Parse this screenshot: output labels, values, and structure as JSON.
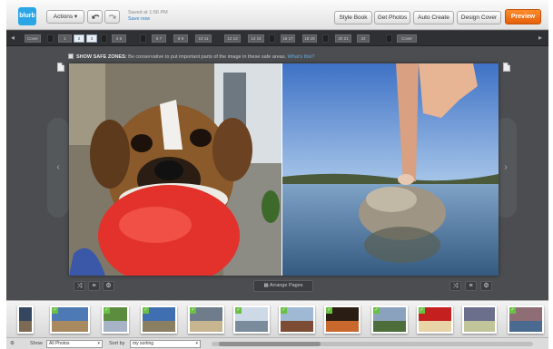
{
  "toolbar": {
    "logo": "blurb",
    "actions_label": "Actions ▾",
    "undo_icon": "undo-icon",
    "redo_icon": "redo-icon",
    "saved_text": "Saved at 1:56 PM",
    "save_now_label": "Save now",
    "style_book_label": "Style Book",
    "get_photos_label": "Get Photos",
    "auto_create_label": "Auto Create",
    "design_cover_label": "Design Cover",
    "preview_label": "Preview"
  },
  "page_strip": {
    "pages": [
      {
        "label": "Cover"
      },
      {
        "label": "1"
      },
      {
        "label": "2",
        "active": true
      },
      {
        "label": "3",
        "active": true
      },
      {
        "label": "4 5"
      },
      {
        "label": "6 7"
      },
      {
        "label": "8 9"
      },
      {
        "label": "10 11"
      },
      {
        "label": "12 13"
      },
      {
        "label": "14 15"
      },
      {
        "label": "16 17"
      },
      {
        "label": "18 19"
      },
      {
        "label": "20 21"
      },
      {
        "label": "22"
      },
      {
        "label": "Cover"
      }
    ]
  },
  "safe_zones": {
    "label": "SHOW SAFE ZONES:",
    "text": "Be conservative to put important parts of the image in these safe areas.",
    "help": "What's this?"
  },
  "spread": {
    "left_photo": "boxer dog holding red ball",
    "right_photo": "finger balancing on rock in lake"
  },
  "controls": {
    "arrange_pages_label": "Arrange Pages"
  },
  "filmstrip": {
    "thumbs": [
      {
        "colors": [
          "#35475e",
          "#7c6a55"
        ],
        "checked": false
      },
      {
        "colors": [
          "#4d7ab5",
          "#a9895f"
        ],
        "checked": true
      },
      {
        "colors": [
          "#5c8d3f",
          "#a7b4c7"
        ],
        "checked": true
      },
      {
        "colors": [
          "#3f6fb0",
          "#8a7e63"
        ],
        "checked": true
      },
      {
        "colors": [
          "#6f7c8c",
          "#c7b58f"
        ],
        "checked": true
      },
      {
        "colors": [
          "#cdd9e6",
          "#7a8c9b"
        ],
        "checked": true
      },
      {
        "colors": [
          "#9fb8d4",
          "#7c4c35"
        ],
        "checked": true
      },
      {
        "colors": [
          "#2a1d14",
          "#c8682c"
        ],
        "checked": true
      },
      {
        "colors": [
          "#8aa2bd",
          "#4d6d3a"
        ],
        "checked": true
      },
      {
        "colors": [
          "#c42020",
          "#e9d4a8"
        ],
        "checked": true
      },
      {
        "colors": [
          "#6c6f8c",
          "#c1c59a"
        ],
        "checked": false
      },
      {
        "colors": [
          "#8e6d75",
          "#4a6a90"
        ],
        "checked": true
      }
    ]
  },
  "bottom": {
    "show_label": "Show",
    "show_value": "All Photos",
    "sort_label": "Sort by",
    "sort_value": "my sorting"
  }
}
